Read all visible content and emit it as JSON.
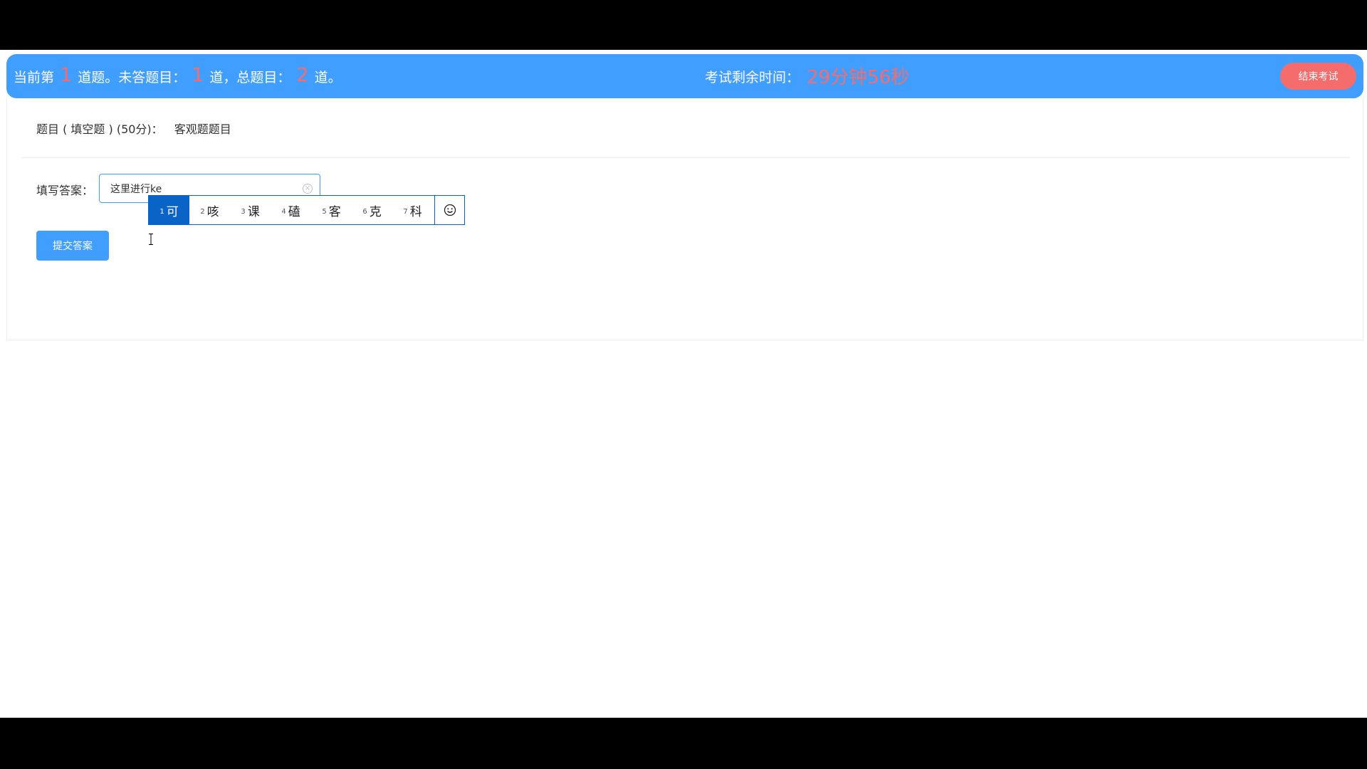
{
  "header": {
    "progress_prefix": "当前第",
    "current_question": "1",
    "progress_middle1": "道题。未答题目：",
    "unanswered": "1",
    "progress_middle2": "道，总题目：",
    "total": "2",
    "progress_suffix": "道。",
    "timer_label": "考试剩余时间：",
    "timer_value": "29分钟56秒",
    "end_button": "结束考试"
  },
  "question": {
    "label": "题目 ( 填空题 ) (50分)：",
    "title": "客观题题目"
  },
  "answer": {
    "label": "填写答案：",
    "placeholder": "这里进行",
    "value": "这里进行ke"
  },
  "ime": {
    "candidates": [
      {
        "index": "1",
        "char": "可"
      },
      {
        "index": "2",
        "char": "咳"
      },
      {
        "index": "3",
        "char": "课"
      },
      {
        "index": "4",
        "char": "磕"
      },
      {
        "index": "5",
        "char": "客"
      },
      {
        "index": "6",
        "char": "克"
      },
      {
        "index": "7",
        "char": "科"
      }
    ],
    "emoji_icon": "smiley-icon"
  },
  "submit_button": "提交答案",
  "colors": {
    "primary": "#409eff",
    "danger": "#f56c6c",
    "ime_highlight": "#0a64c8"
  }
}
